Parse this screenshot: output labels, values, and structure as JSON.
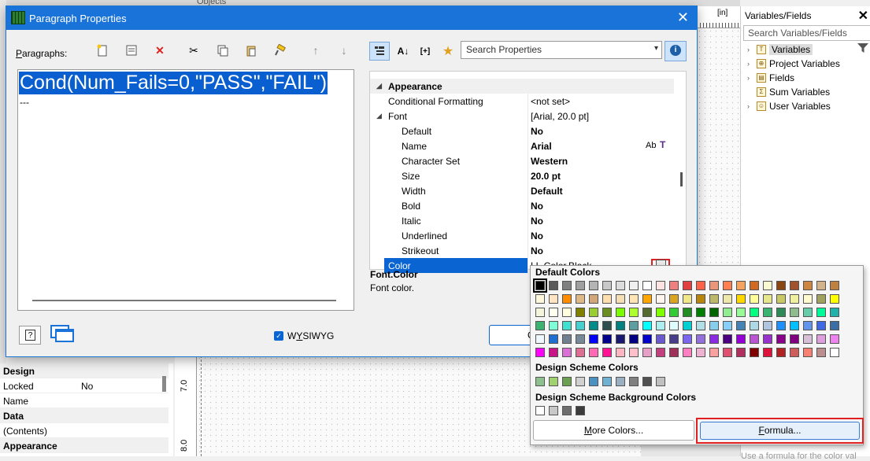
{
  "background": {
    "objects_label": "Objects",
    "ruler_unit": "[in]",
    "ruler_marks": [
      "7.0",
      "8.0"
    ]
  },
  "variables_panel": {
    "title": "Variables/Fields",
    "close": "✕",
    "search_placeholder": "Search Variables/Fields",
    "items": [
      {
        "label": "Variables",
        "icon": "T",
        "expandable": true
      },
      {
        "label": "Project Variables",
        "icon": "⊕",
        "expandable": true
      },
      {
        "label": "Fields",
        "icon": "▤",
        "expandable": true
      },
      {
        "label": "Sum Variables",
        "icon": "Σ",
        "expandable": false
      },
      {
        "label": "User Variables",
        "icon": "☺",
        "expandable": true
      }
    ],
    "footer_text": "Use a formula for the color val"
  },
  "left_props": {
    "rows": [
      {
        "key": "Design",
        "value": "",
        "header": true
      },
      {
        "key": "Locked",
        "value": "No",
        "header": false
      },
      {
        "key": "Name",
        "value": "",
        "header": false
      },
      {
        "key": "Data",
        "value": "",
        "header": true
      },
      {
        "key": "(Contents)",
        "value": "",
        "header": false
      },
      {
        "key": "Appearance",
        "value": "",
        "header": true
      }
    ]
  },
  "dialog": {
    "title": "Paragraph Properties",
    "close": "✕",
    "paragraphs_label": "Paragraphs:",
    "editor_line1": "Cond(Num_Fails=0,\"PASS\",\"FAIL\")",
    "editor_line2": "---",
    "search_placeholder": "Search Properties",
    "toolbar_sort_label": "[+]",
    "wysiwyg_label": "WYSIWYG",
    "ok_partial": "O",
    "property_rows": [
      {
        "key": "Appearance",
        "value": "",
        "indent": 0,
        "cat": true,
        "twisty": "◢"
      },
      {
        "key": "Conditional Formatting",
        "value": "<not set>",
        "indent": 1,
        "cat": false
      },
      {
        "key": "Font",
        "value": "[Arial, 20.0 pt]",
        "indent": 1,
        "cat": false,
        "twisty": "◢"
      },
      {
        "key": "Default",
        "value": "No",
        "indent": 2,
        "bold": true
      },
      {
        "key": "Name",
        "value": "Arial",
        "indent": 2,
        "bold": true
      },
      {
        "key": "Character Set",
        "value": "Western",
        "indent": 2,
        "bold": true
      },
      {
        "key": "Size",
        "value": "20.0 pt",
        "indent": 2,
        "bold": true
      },
      {
        "key": "Width",
        "value": "Default",
        "indent": 2,
        "bold": true
      },
      {
        "key": "Bold",
        "value": "No",
        "indent": 2,
        "bold": true
      },
      {
        "key": "Italic",
        "value": "No",
        "indent": 2,
        "bold": true
      },
      {
        "key": "Underlined",
        "value": "No",
        "indent": 2,
        "bold": true
      },
      {
        "key": "Strikeout",
        "value": "No",
        "indent": 2,
        "bold": true
      },
      {
        "key": "Color",
        "value": "LL.Color.Black",
        "indent": 2,
        "selected": true
      }
    ],
    "name_extra": "Ab",
    "desc_title": "Font.Color",
    "desc_body": "Font color."
  },
  "color_popup": {
    "default_title": "Default Colors",
    "scheme_title": "Design Scheme Colors",
    "scheme_bg_title": "Design Scheme Background Colors",
    "more_label": "More Colors...",
    "formula_label": "Formula...",
    "default_colors": [
      [
        "#000000",
        "#5a5a5a",
        "#808080",
        "#a0a0a0",
        "#b4b4b4",
        "#c8c8c8",
        "#dcdcdc",
        "#f0f0f0",
        "#ffffff",
        "#ffe4e1",
        "#f08080",
        "#e04040",
        "#ff6347",
        "#e9967a",
        "#ff7f50",
        "#f4a460",
        "#d2691e",
        "#fafad2",
        "#8b4513",
        "#a0522d",
        "#cd853f",
        "#d2b48c",
        "#c08040"
      ],
      [
        "#fff8dc",
        "#ffe4c4",
        "#ff8c00",
        "#deb887",
        "#d2a679",
        "#ffdead",
        "#f5deb3",
        "#ffe4b5",
        "#ffa500",
        "#fff5ee",
        "#daa520",
        "#f0e68c",
        "#b8860b",
        "#bdb76b",
        "#eee8aa",
        "#ffd700",
        "#ffff99",
        "#e6e68c",
        "#c8c864",
        "#f0f0a0",
        "#fffacd",
        "#a0a060",
        "#ffff00"
      ],
      [
        "#f5f5dc",
        "#fffff0",
        "#ffffe0",
        "#808000",
        "#9acd32",
        "#6b8e23",
        "#7cfc00",
        "#adff2f",
        "#556b2f",
        "#7fff00",
        "#32cd32",
        "#228b22",
        "#008000",
        "#006400",
        "#90ee90",
        "#98fb98",
        "#00ff7f",
        "#3cb371",
        "#2e8b57",
        "#8fbc8f",
        "#66cdaa",
        "#00fa9a",
        "#20b2aa"
      ],
      [
        "#3cb371",
        "#7fffd4",
        "#40e0d0",
        "#48d1cc",
        "#008b8b",
        "#2f4f4f",
        "#008080",
        "#5f9ea0",
        "#00ffff",
        "#afeeee",
        "#e0ffff",
        "#00ced1",
        "#b0e0e6",
        "#87ceeb",
        "#87cefa",
        "#4682b4",
        "#add8e6",
        "#b0c4de",
        "#1e90ff",
        "#00bfff",
        "#6495ed",
        "#4169e1",
        "#3a6ea5"
      ],
      [
        "#f0f8ff",
        "#1e6fd0",
        "#708090",
        "#778899",
        "#0000ff",
        "#00008b",
        "#191970",
        "#000080",
        "#0000cd",
        "#6a5acd",
        "#483d8b",
        "#7b68ee",
        "#9370db",
        "#8a2be2",
        "#4b0082",
        "#9400d3",
        "#ba55d3",
        "#9932cc",
        "#8b008b",
        "#800080",
        "#d8bfd8",
        "#dda0dd",
        "#ee82ee"
      ],
      [
        "#ff00ff",
        "#c71585",
        "#da70d6",
        "#db7093",
        "#ff69b4",
        "#ff1493",
        "#ffb6c1",
        "#ffc0cb",
        "#e6a0c8",
        "#c04080",
        "#a0305a",
        "#ff80c0",
        "#f0b0d0",
        "#ffa0a0",
        "#e05070",
        "#b03060",
        "#800000",
        "#dc143c",
        "#b22222",
        "#cd5c5c",
        "#fa8072",
        "#bc8f8f",
        "#ffffff"
      ]
    ],
    "scheme_colors": [
      "#8cc08c",
      "#a0d070",
      "#6aa050",
      "#d0d0d0",
      "#4a90c0",
      "#70b0d0",
      "#9ab0c0",
      "#808080",
      "#505050",
      "#c0c0c0"
    ],
    "scheme_bg_colors": [
      "#ffffff",
      "#c8c8c8",
      "#6e6e6e",
      "#3c3c3c"
    ]
  }
}
